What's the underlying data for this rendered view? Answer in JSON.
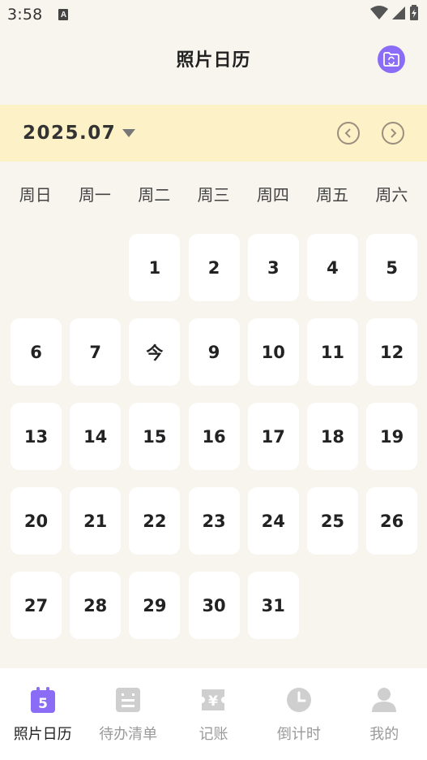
{
  "status_bar": {
    "time": "3:58",
    "notification_letter": "A"
  },
  "header": {
    "title": "照片日历"
  },
  "month_bar": {
    "month": "2025.07"
  },
  "weekdays": [
    "周日",
    "周一",
    "周二",
    "周三",
    "周四",
    "周五",
    "周六"
  ],
  "calendar": {
    "leading_blanks": 2,
    "days": [
      "1",
      "2",
      "3",
      "4",
      "5",
      "6",
      "7",
      "今",
      "9",
      "10",
      "11",
      "12",
      "13",
      "14",
      "15",
      "16",
      "17",
      "18",
      "19",
      "20",
      "21",
      "22",
      "23",
      "24",
      "25",
      "26",
      "27",
      "28",
      "29",
      "30",
      "31"
    ]
  },
  "tabs": [
    {
      "label": "照片日历",
      "icon": "calendar-icon",
      "active": true,
      "badge": "5"
    },
    {
      "label": "待办清单",
      "icon": "todo-list-icon",
      "active": false
    },
    {
      "label": "记账",
      "icon": "yen-ledger-icon",
      "active": false
    },
    {
      "label": "倒计时",
      "icon": "clock-icon",
      "active": false
    },
    {
      "label": "我的",
      "icon": "profile-icon",
      "active": false
    }
  ],
  "colors": {
    "accent": "#8a6cf6",
    "background": "#f8f5ee",
    "month_bar": "#fdf1c7",
    "inactive_icon": "#c9c9c9"
  }
}
